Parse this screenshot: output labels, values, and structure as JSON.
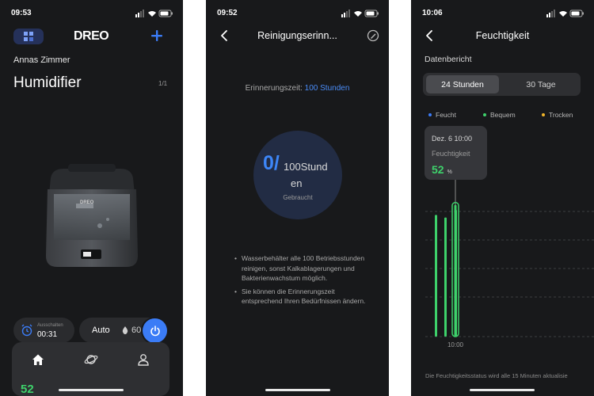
{
  "screen1": {
    "status_time": "09:53",
    "logo": "DREO",
    "room": "Annas Zimmer",
    "device_name": "Humidifier",
    "page_count": "1/1",
    "timer_label": "Ausschalten",
    "timer_value": "00:31",
    "mode": "Auto",
    "humidity_target": "60",
    "current_humidity": "52",
    "device_logo": "DREO",
    "accent": "#3b7cf6"
  },
  "screen2": {
    "status_time": "09:52",
    "title": "Reinigungserinn...",
    "reminder_label": "Erinnerungszeit:",
    "reminder_value": "100 Stunden",
    "used_value": "0/",
    "total_part1": "100Stund",
    "total_part2": "en",
    "status_text": "Gebraucht",
    "tips": [
      "Wasserbehälter alle 100 Betriebsstunden reinigen, sonst Kalkablagerungen und Bakterienwachstum möglich.",
      "Sie können die Erinnerungszeit entsprechend Ihren Bedürfnissen ändern."
    ]
  },
  "screen3": {
    "status_time": "10:06",
    "title": "Feuchtigkeit",
    "section": "Datenbericht",
    "tabs": [
      "24 Stunden",
      "30 Tage"
    ],
    "legend": [
      {
        "label": "Feucht",
        "color": "#3b7cf6"
      },
      {
        "label": "Bequem",
        "color": "#3ed16b"
      },
      {
        "label": "Trocken",
        "color": "#f0b429"
      }
    ],
    "tooltip": {
      "date": "Dez. 6 10:00",
      "metric": "Feuchtigkeit",
      "value": "52",
      "unit": "%"
    },
    "x_label": "10:00",
    "footnote": "Die Feuchtigkeitsstatus wird alle 15 Minuten aktualisie"
  },
  "chart_data": {
    "type": "bar",
    "categories": [
      "",
      "",
      "",
      "10:00"
    ],
    "values": [
      48,
      47,
      50,
      52
    ],
    "highlighted_index": 3,
    "bar_color": "#3ed16b",
    "xlabel": "",
    "ylabel": "",
    "ylim": [
      0,
      100
    ],
    "grid": true
  }
}
